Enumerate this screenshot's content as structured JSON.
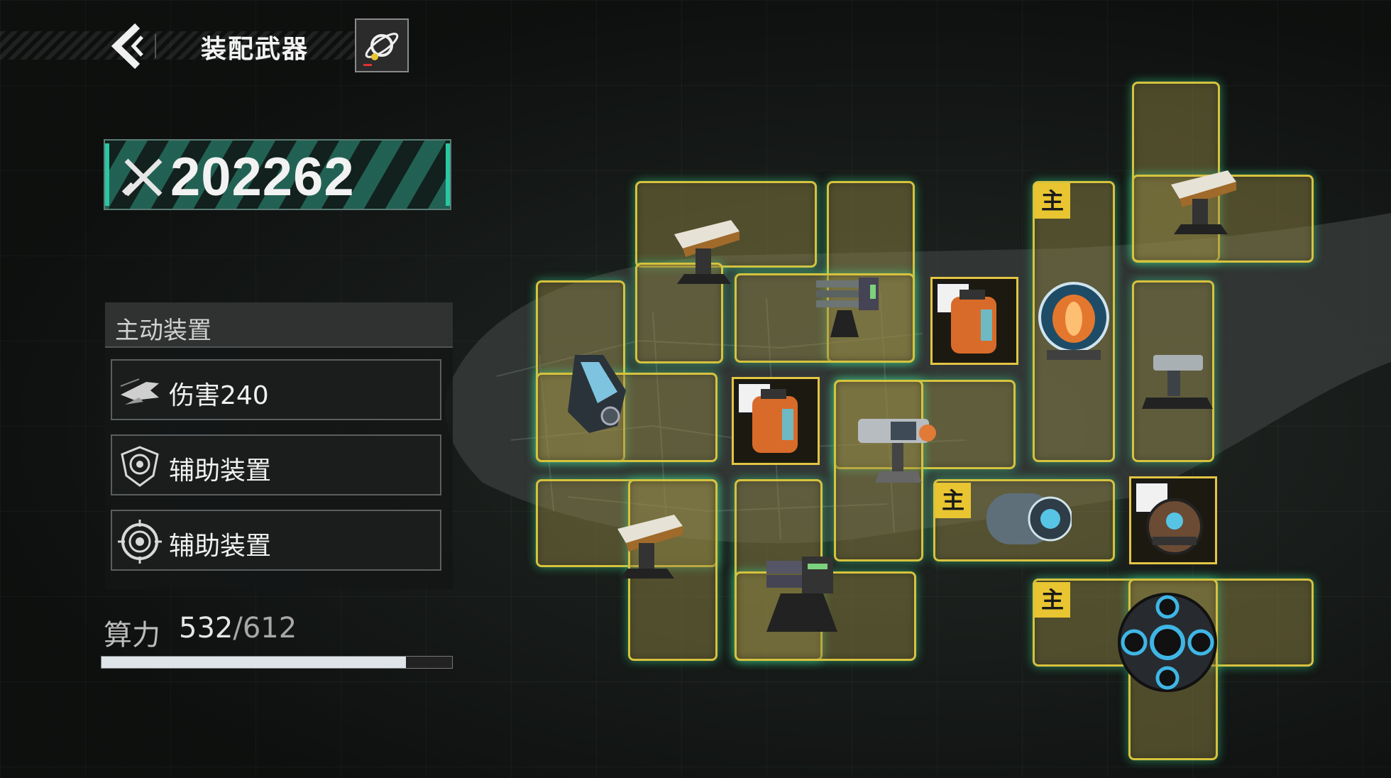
{
  "header": {
    "title": "装配武器"
  },
  "power": {
    "value": "202262"
  },
  "equipment": {
    "header": "主动装置",
    "items": [
      {
        "label": "伤害240"
      },
      {
        "label": "辅助装置"
      },
      {
        "label": "辅助装置"
      }
    ]
  },
  "compute": {
    "label": "算力",
    "current": "532",
    "max": "/612",
    "progress": 0.869
  },
  "grid": {
    "main_tag": "主"
  },
  "colors": {
    "slot_border": "#d7c23e",
    "accent": "#29c7a2",
    "main_tag": "#e8c531"
  }
}
